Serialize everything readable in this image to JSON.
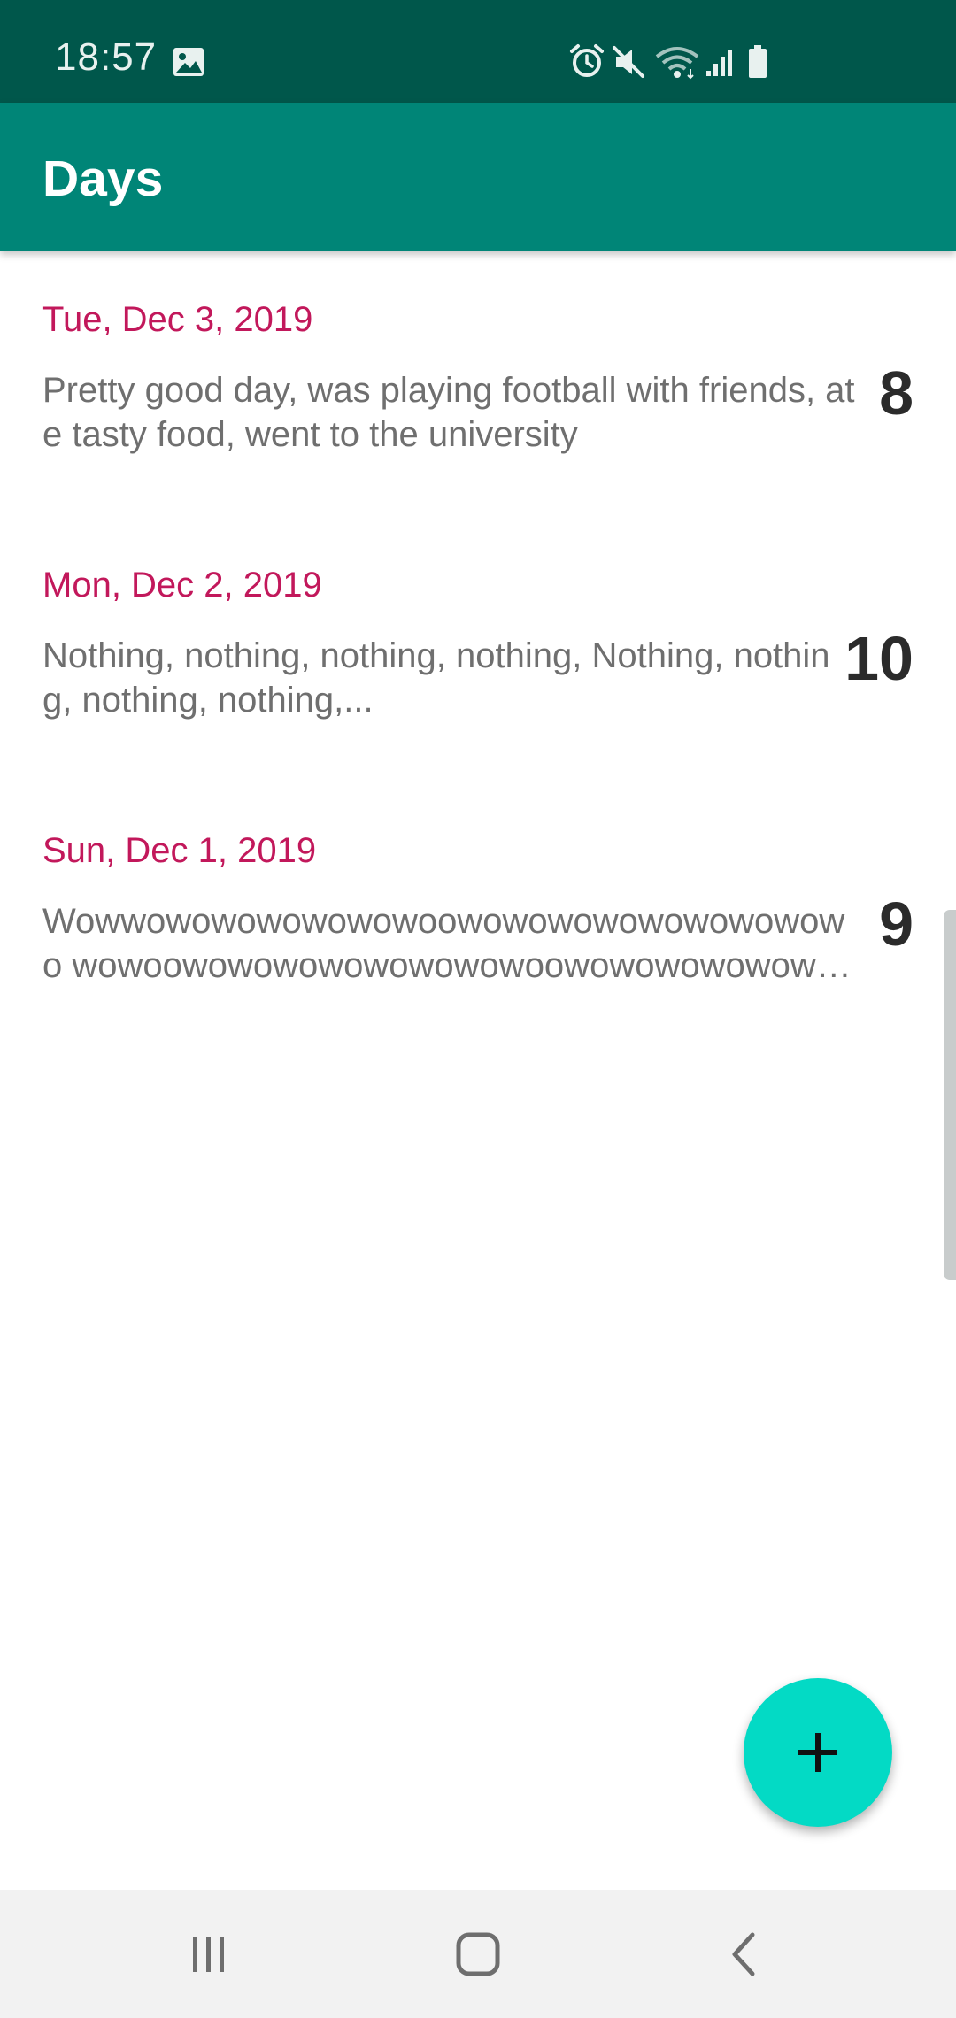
{
  "status_bar": {
    "time": "18:57",
    "icons": [
      "image-icon",
      "alarm-icon",
      "mute-icon",
      "wifi-icon",
      "signal-icon",
      "battery-icon"
    ]
  },
  "app_bar": {
    "title": "Days"
  },
  "days": [
    {
      "date": "Tue, Dec 3, 2019",
      "description": "Pretty good day, was playing football with friends, ate tasty food, went to the university",
      "score": "8"
    },
    {
      "date": "Mon, Dec 2, 2019",
      "description": "Nothing, nothing, nothing, nothing, Nothing, nothing, nothing, nothing,...",
      "score": "10"
    },
    {
      "date": "Sun, Dec 1, 2019",
      "description": "Wowwowowowowowowoowowowowowowowowowo wowoowowowowowowowowoowowowowowowowowo...",
      "score": "9"
    }
  ],
  "fab": {
    "icon": "plus-icon"
  },
  "nav_bar": {
    "icons": [
      "recent-apps-icon",
      "home-icon",
      "back-icon"
    ]
  },
  "colors": {
    "status_bar": "#00574b",
    "app_bar": "#008577",
    "date_accent": "#c2185b",
    "fab": "#03dac5"
  }
}
